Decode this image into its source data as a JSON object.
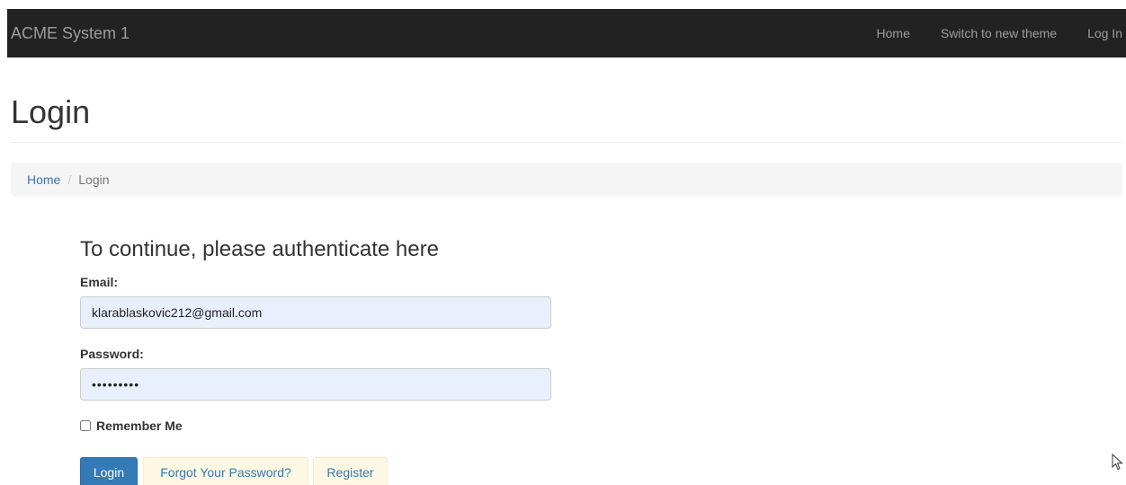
{
  "navbar": {
    "brand": "ACME System 1",
    "links": [
      "Home",
      "Switch to new theme",
      "Log In"
    ]
  },
  "page": {
    "title": "Login"
  },
  "breadcrumb": {
    "home": "Home",
    "separator": "/",
    "current": "Login"
  },
  "form": {
    "heading": "To continue, please authenticate here",
    "email_label": "Email:",
    "email_value": "klarablaskovic212@gmail.com",
    "password_label": "Password:",
    "password_value": "•••••••••",
    "remember_label": "Remember Me",
    "remember_checked": false
  },
  "buttons": {
    "login": "Login",
    "forgot": "Forgot Your Password?",
    "register": "Register"
  },
  "colors": {
    "navbar_bg": "#222222",
    "primary": "#337ab7",
    "warning_bg": "#fcf8e3",
    "autofill_bg": "#e8f0fe"
  }
}
